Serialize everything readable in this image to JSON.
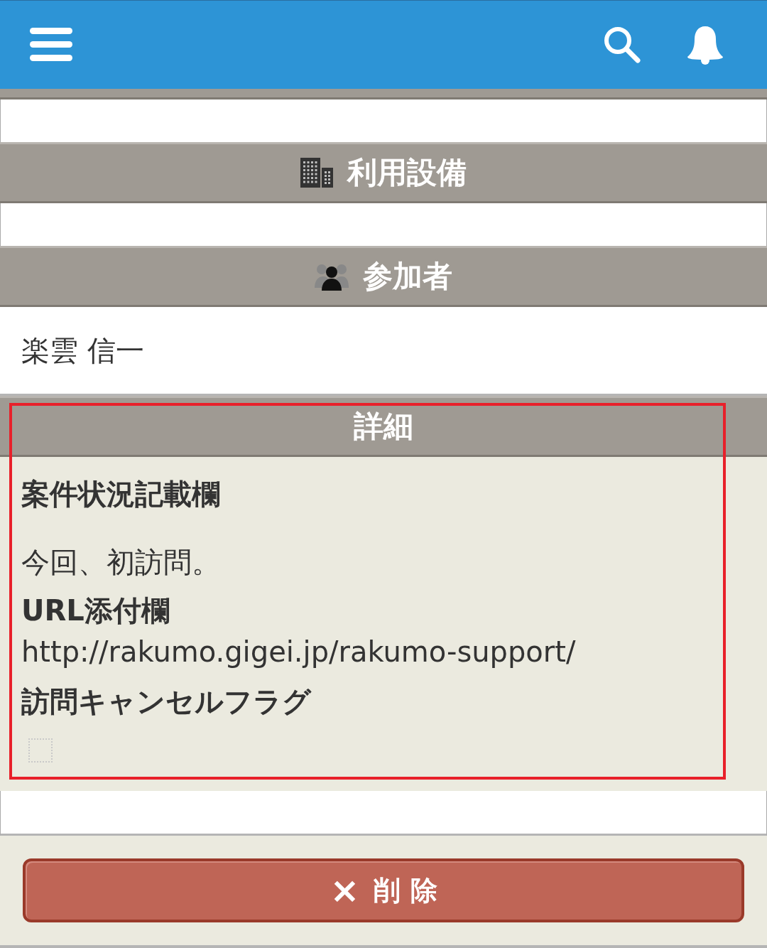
{
  "app_bar": {
    "actions": [
      {
        "kind": "search"
      },
      {
        "kind": "bell"
      }
    ]
  },
  "sections": [
    {
      "title": "利用設備",
      "kind": "building"
    },
    {
      "title": "参加者",
      "kind": "people",
      "entries": [
        "楽雲 信一"
      ]
    },
    {
      "title": "詳細",
      "kind": "plain",
      "highlighted": true,
      "fields": [
        {
          "label": "案件状況記載欄",
          "kind": "text",
          "value": "今回、初訪問。"
        },
        {
          "label": "URL添付欄",
          "kind": "link",
          "value": "http://rakumo.gigei.jp/rakumo-support/"
        },
        {
          "label": "訪問キャンセルフラグ",
          "kind": "checkbox",
          "checked": false
        }
      ]
    }
  ],
  "delete_button": {
    "icon": "×",
    "label": "削 除"
  }
}
